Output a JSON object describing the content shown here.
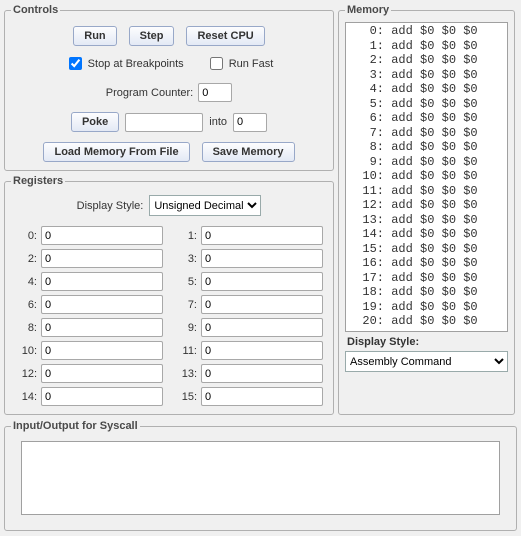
{
  "controls": {
    "legend": "Controls",
    "run_label": "Run",
    "step_label": "Step",
    "reset_label": "Reset CPU",
    "stop_bp_label": "Stop at Breakpoints",
    "stop_bp_checked": true,
    "run_fast_label": "Run Fast",
    "run_fast_checked": false,
    "pc_label": "Program Counter:",
    "pc_value": "0",
    "poke_label": "Poke",
    "poke_value": "",
    "poke_into_label": "into",
    "poke_addr": "0",
    "load_label": "Load Memory From File",
    "save_label": "Save Memory"
  },
  "registers": {
    "legend": "Registers",
    "style_label": "Display Style:",
    "style_value": "Unsigned Decimal",
    "regs": [
      {
        "idx": "0",
        "val": "0"
      },
      {
        "idx": "1",
        "val": "0"
      },
      {
        "idx": "2",
        "val": "0"
      },
      {
        "idx": "3",
        "val": "0"
      },
      {
        "idx": "4",
        "val": "0"
      },
      {
        "idx": "5",
        "val": "0"
      },
      {
        "idx": "6",
        "val": "0"
      },
      {
        "idx": "7",
        "val": "0"
      },
      {
        "idx": "8",
        "val": "0"
      },
      {
        "idx": "9",
        "val": "0"
      },
      {
        "idx": "10",
        "val": "0"
      },
      {
        "idx": "11",
        "val": "0"
      },
      {
        "idx": "12",
        "val": "0"
      },
      {
        "idx": "13",
        "val": "0"
      },
      {
        "idx": "14",
        "val": "0"
      },
      {
        "idx": "15",
        "val": "0"
      }
    ]
  },
  "memory": {
    "legend": "Memory",
    "style_label": "Display Style:",
    "style_value": "Assembly Command",
    "rows": [
      {
        "addr": "0",
        "text": "add $0 $0 $0"
      },
      {
        "addr": "1",
        "text": "add $0 $0 $0"
      },
      {
        "addr": "2",
        "text": "add $0 $0 $0"
      },
      {
        "addr": "3",
        "text": "add $0 $0 $0"
      },
      {
        "addr": "4",
        "text": "add $0 $0 $0"
      },
      {
        "addr": "5",
        "text": "add $0 $0 $0"
      },
      {
        "addr": "6",
        "text": "add $0 $0 $0"
      },
      {
        "addr": "7",
        "text": "add $0 $0 $0"
      },
      {
        "addr": "8",
        "text": "add $0 $0 $0"
      },
      {
        "addr": "9",
        "text": "add $0 $0 $0"
      },
      {
        "addr": "10",
        "text": "add $0 $0 $0"
      },
      {
        "addr": "11",
        "text": "add $0 $0 $0"
      },
      {
        "addr": "12",
        "text": "add $0 $0 $0"
      },
      {
        "addr": "13",
        "text": "add $0 $0 $0"
      },
      {
        "addr": "14",
        "text": "add $0 $0 $0"
      },
      {
        "addr": "15",
        "text": "add $0 $0 $0"
      },
      {
        "addr": "16",
        "text": "add $0 $0 $0"
      },
      {
        "addr": "17",
        "text": "add $0 $0 $0"
      },
      {
        "addr": "18",
        "text": "add $0 $0 $0"
      },
      {
        "addr": "19",
        "text": "add $0 $0 $0"
      },
      {
        "addr": "20",
        "text": "add $0 $0 $0"
      }
    ]
  },
  "io": {
    "legend": "Input/Output for Syscall",
    "value": ""
  }
}
